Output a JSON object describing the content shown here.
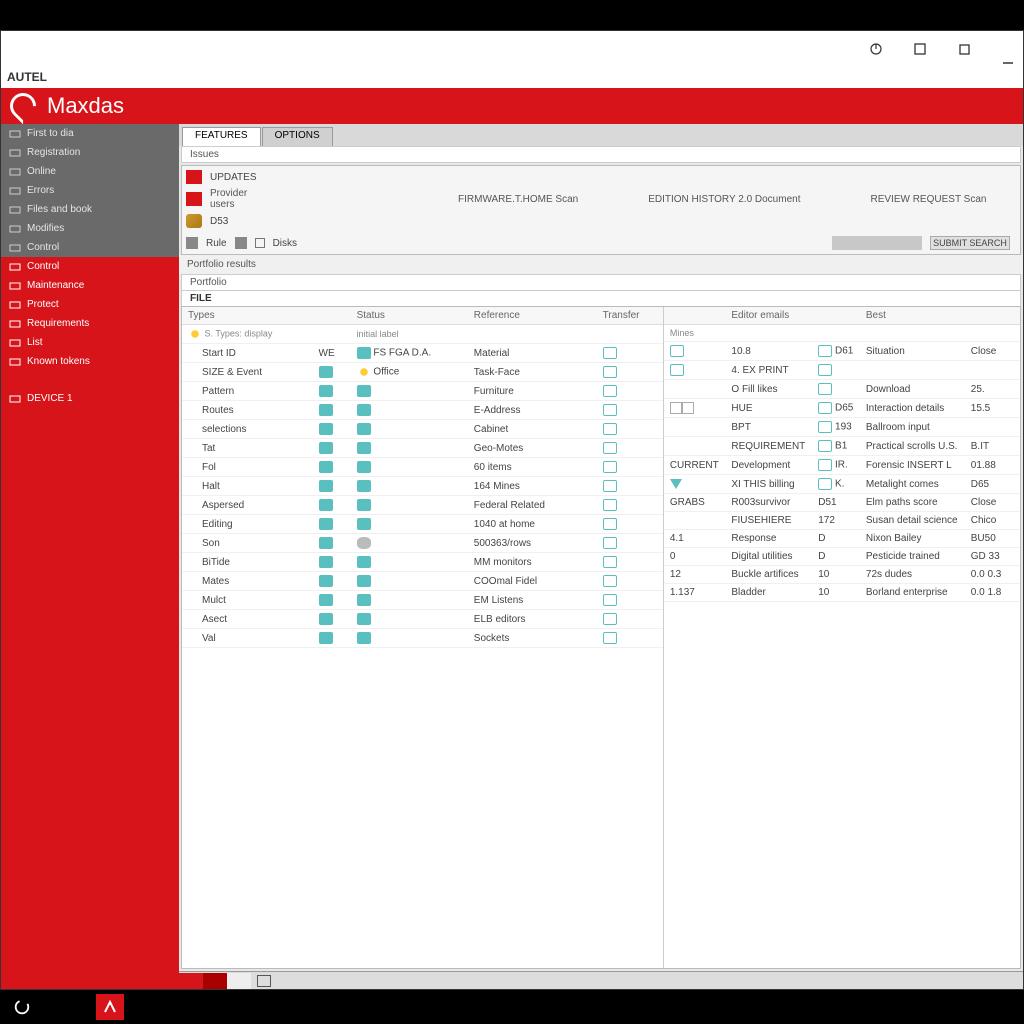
{
  "window": {
    "app_label": "AUTEL"
  },
  "brand": {
    "name": "Maxdas"
  },
  "sidebar": {
    "top": [
      {
        "label": "First to dia"
      },
      {
        "label": "Registration"
      },
      {
        "label": "Online"
      },
      {
        "label": "Errors"
      },
      {
        "label": "Files and book"
      },
      {
        "label": "Modifies"
      },
      {
        "label": "Control"
      }
    ],
    "bottom": [
      {
        "label": "Control"
      },
      {
        "label": "Maintenance"
      },
      {
        "label": "Protect"
      },
      {
        "label": "Requirements"
      },
      {
        "label": "List"
      },
      {
        "label": "Known tokens"
      }
    ],
    "footer": [
      {
        "label": "DEVICE 1"
      }
    ]
  },
  "tabs": [
    {
      "label": "FEATURES",
      "active": true
    },
    {
      "label": "OPTIONS",
      "active": false
    }
  ],
  "subtab": "Issues",
  "toolbar": {
    "row1_label": "UPDATES",
    "row2_a": "Provider users",
    "row2_b": "D53",
    "links": [
      "FIRMWARE.T.HOME Scan",
      "EDITION HISTORY 2.0 Document",
      "REVIEW REQUEST Scan"
    ],
    "row3_a": "Rule",
    "row3_b": "Disks",
    "search_btn": "SUBMIT SEARCH"
  },
  "crumb": "Portfolio results",
  "panel_sub1": "Portfolio",
  "panel_sub2": "FILE",
  "left": {
    "headers": [
      "Types",
      "",
      "Status",
      "Reference",
      "",
      "Transfer"
    ],
    "group": {
      "c1": "S. Types: display",
      "c3": "initial label"
    },
    "rows": [
      {
        "c1": "Start ID",
        "c2": "WE",
        "c3": "FS  FGA  D.A.",
        "c4": "Material",
        "c5": ""
      },
      {
        "c1": "SIZE & Event",
        "c2": "",
        "c3": "Office",
        "c4": "Task-Face",
        "c5": ""
      },
      {
        "c1": "Pattern",
        "c2": "",
        "c3": "",
        "c4": "Furniture",
        "c5": ""
      },
      {
        "c1": "Routes",
        "c2": "",
        "c3": "",
        "c4": "E-Address",
        "c5": ""
      },
      {
        "c1": "selections",
        "c2": "",
        "c3": "",
        "c4": "Cabinet",
        "c5": ""
      },
      {
        "c1": "Tat",
        "c2": "",
        "c3": "",
        "c4": "Geo-Motes",
        "c5": ""
      },
      {
        "c1": "Fol",
        "c2": "",
        "c3": "",
        "c4": "60 items",
        "c5": ""
      },
      {
        "c1": "Halt",
        "c2": "",
        "c3": "",
        "c4": "164 Mines",
        "c5": ""
      },
      {
        "c1": "Aspersed",
        "c2": "",
        "c3": "",
        "c4": "Federal Related",
        "c5": ""
      },
      {
        "c1": "Editing",
        "c2": "",
        "c3": "",
        "c4": "1040 at home",
        "c5": ""
      },
      {
        "c1": "Son",
        "c2": "",
        "c3": "",
        "c4": "500363/rows",
        "c5": ""
      },
      {
        "c1": "BiTide",
        "c2": "",
        "c3": "",
        "c4": "MM monitors",
        "c5": ""
      },
      {
        "c1": "Mates",
        "c2": "",
        "c3": "",
        "c4": "COOmal Fidel",
        "c5": ""
      },
      {
        "c1": "Mulct",
        "c2": "",
        "c3": "",
        "c4": "EM Listens",
        "c5": ""
      },
      {
        "c1": "Asect",
        "c2": "",
        "c3": "",
        "c4": "ELB editors",
        "c5": ""
      },
      {
        "c1": "Val",
        "c2": "",
        "c3": "",
        "c4": "Sockets",
        "c5": ""
      }
    ]
  },
  "right": {
    "headers": [
      "",
      "Editor emails",
      "",
      "Best",
      "",
      ""
    ],
    "group": "Mines",
    "rows": [
      {
        "c1": "",
        "c2": "10.8",
        "c3": "D61",
        "c4": "Situation",
        "c5": "Close"
      },
      {
        "c1": "",
        "c2": "4. EX PRINT",
        "c3": "",
        "c4": "",
        "c5": ""
      },
      {
        "c1": "",
        "c2": "O Fill likes",
        "c3": "",
        "c4": "Download",
        "c5": "25."
      },
      {
        "c1": "",
        "c2": "HUE",
        "c3": "D65",
        "c4": "Interaction details",
        "c5": "15.5"
      },
      {
        "c1": "",
        "c2": "BPT",
        "c3": "193",
        "c4": "Ballroom input",
        "c5": ""
      },
      {
        "c1": "",
        "c2": "REQUIREMENT",
        "c3": "B1",
        "c4": "Practical scrolls U.S.",
        "c5": "B.IT"
      },
      {
        "c1": "CURRENT",
        "c2": "Development",
        "c3": "IR.",
        "c4": "Forensic INSERT L",
        "c5": "01.88"
      },
      {
        "c1": "",
        "c2": "XI THIS billing",
        "c3": "K.",
        "c4": "Metalight comes",
        "c5": "D65"
      },
      {
        "c1": "GRABS",
        "c2": "R003survivor",
        "c3": "D51",
        "c4": "Elm paths score",
        "c5": "Close"
      },
      {
        "c1": "",
        "c2": "FIUSEHIERE",
        "c3": "172",
        "c4": "Susan detail science",
        "c5": "Chico"
      },
      {
        "c1": "4.1",
        "c2": "Response",
        "c3": "D",
        "c4": "Nixon Bailey",
        "c5": "BU50"
      },
      {
        "c1": "0",
        "c2": "Digital utilities",
        "c3": "D",
        "c4": "Pesticide trained",
        "c5": "GD 33"
      },
      {
        "c1": "12",
        "c2": "Buckle artifices",
        "c3": "10",
        "c4": "72s dudes",
        "c5": "0.0 0.3"
      },
      {
        "c1": "1.137",
        "c2": "Bladder",
        "c3": "10",
        "c4": "Borland enterprise",
        "c5": "0.0 1.8"
      }
    ]
  }
}
